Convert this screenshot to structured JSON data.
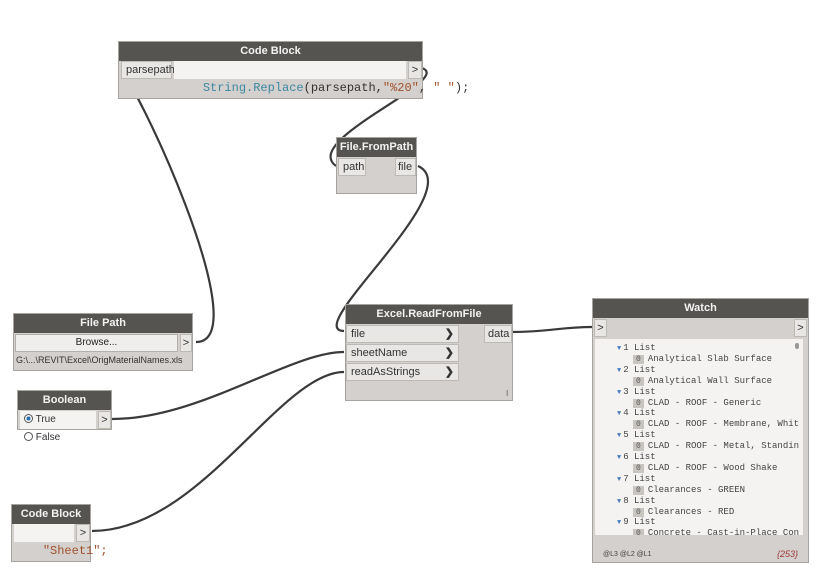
{
  "nodes": {
    "code_block_1": {
      "title": "Code Block",
      "input": "parsepath",
      "code_fn": "String.Replace",
      "code_rest": "(parsepath,",
      "code_str1": "\"%20\"",
      "code_comma": ", ",
      "code_str2": "\" \"",
      "code_end": ");",
      "output": ">"
    },
    "file_from_path": {
      "title": "File.FromPath",
      "input": "path",
      "output": "file"
    },
    "file_path": {
      "title": "File Path",
      "button": "Browse...",
      "output": ">",
      "value": "G:\\...\\REVIT\\Excel\\OrigMaterialNames.xls"
    },
    "boolean": {
      "title": "Boolean",
      "opt_true": "True",
      "opt_false": "False",
      "output": ">"
    },
    "code_block_2": {
      "title": "Code Block",
      "code": "\"Sheet1\";",
      "output": ">"
    },
    "excel_read": {
      "title": "Excel.ReadFromFile",
      "inputs": [
        "file",
        "sheetName",
        "readAsStrings"
      ],
      "output": "data",
      "lacing": "l"
    },
    "watch": {
      "title": "Watch",
      "input": ">",
      "output": ">",
      "items": [
        {
          "list": "1 List",
          "index": "0",
          "value": "Analytical Slab Surface"
        },
        {
          "list": "2 List",
          "index": "0",
          "value": "Analytical Wall Surface"
        },
        {
          "list": "3 List",
          "index": "0",
          "value": "CLAD - ROOF - Generic"
        },
        {
          "list": "4 List",
          "index": "0",
          "value": "CLAD - ROOF - Membrane, Whit"
        },
        {
          "list": "5 List",
          "index": "0",
          "value": "CLAD - ROOF - Metal, Standin"
        },
        {
          "list": "6 List",
          "index": "0",
          "value": "CLAD - ROOF - Wood Shake"
        },
        {
          "list": "7 List",
          "index": "0",
          "value": "Clearances - GREEN"
        },
        {
          "list": "8 List",
          "index": "0",
          "value": "Clearances - RED"
        },
        {
          "list": "9 List",
          "index": "0",
          "value": "Concrete - Cast-in-Place Con"
        }
      ],
      "footer_levels": "@L3 @L2 @L1",
      "count": "{253}"
    }
  },
  "colors": {
    "header": "#555451",
    "node_body": "#d3d0cd",
    "wire": "#3a3a3a"
  }
}
